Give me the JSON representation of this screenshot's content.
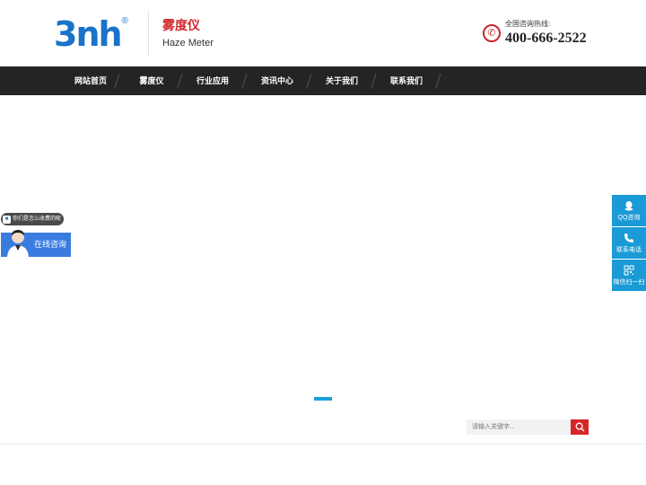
{
  "header": {
    "logo_text": "3nh",
    "logo_reg": "®",
    "brand_cn": "雾度仪",
    "brand_en": "Haze Meter",
    "hotline_label": "全国咨询热线:",
    "hotline_number": "400-666-2522"
  },
  "nav": {
    "items": [
      {
        "label": "网站首页"
      },
      {
        "label": "雾度仪"
      },
      {
        "label": "行业应用"
      },
      {
        "label": "资讯中心"
      },
      {
        "label": "关于我们"
      },
      {
        "label": "联系我们"
      }
    ]
  },
  "chat": {
    "bubble_text": "你们是怎么收费的呢",
    "button_text": "在线咨询"
  },
  "float_right": {
    "items": [
      {
        "label": "QQ咨询",
        "icon": "qq-icon"
      },
      {
        "label": "联系电话",
        "icon": "phone-icon"
      },
      {
        "label": "微信扫一扫",
        "icon": "qrcode-icon"
      }
    ]
  },
  "search": {
    "placeholder": "请输入关键字..."
  },
  "colors": {
    "brand_blue": "#1a73c9",
    "brand_red": "#d2282c",
    "nav_bg": "#242424",
    "accent_blue": "#1aa0d8"
  }
}
